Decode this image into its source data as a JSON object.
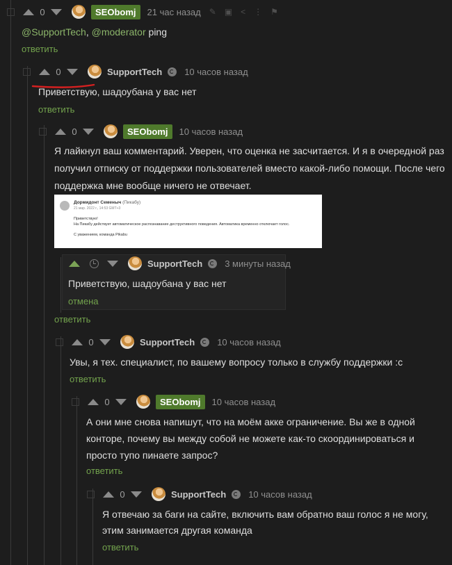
{
  "comments": [
    {
      "score": "0",
      "user": "SEObomj",
      "time": "21 час назад",
      "text_parts": [
        "@SupportTech",
        ", ",
        "@moderator",
        " ping"
      ],
      "reply": "ответить",
      "tools": [
        "link-icon",
        "save-icon",
        "share-icon",
        "more-icon",
        "report-icon"
      ]
    },
    {
      "score": "0",
      "user": "SupportTech",
      "time": "10 часов назад",
      "text": "Приветствую, шадоубана у вас нет",
      "reply": "ответить"
    },
    {
      "score": "0",
      "user": "SEObomj",
      "time": "10 часов назад",
      "lines": [
        "Я лайкнул ваш комментарий. Уверен, что оценка не засчитается. И я в очередной раз",
        "получил отписку от поддержки пользователей вместо какой-либо помощи. После чего",
        "поддержка мне вообще ничего не отвечает."
      ],
      "reply": "ответить",
      "screenshot": {
        "author": "Дормидонт Семеныч",
        "site": "(Пикабу)",
        "date": "21 мар. 2022 г., 14:53 GMT+3",
        "greeting": "Приветствую!",
        "body": "На Пикабу действует автоматическое распознавание деструктивного поведения. Автоматика временно отключает голос.",
        "sign": "С уважением, команда Pikabu"
      }
    },
    {
      "user": "SupportTech",
      "time": "3 минуты назад",
      "text": "Приветствую, шадоубана у вас нет",
      "cancel": "отмена"
    },
    {
      "score": "0",
      "user": "SupportTech",
      "time": "10 часов назад",
      "text": "Увы, я тех. специалист, по вашему вопросу только в службу поддержки :с",
      "reply": "ответить"
    },
    {
      "score": "0",
      "user": "SEObomj",
      "time": "10 часов назад",
      "lines": [
        "А они мне снова напишут, что на моём акке ограничение. Вы же в одной",
        "конторе, почему вы между собой не можете как-то скоординироваться и",
        "просто тупо пинаете запрос?"
      ],
      "reply": "ответить"
    },
    {
      "score": "0",
      "user": "SupportTech",
      "time": "10 часов назад",
      "lines": [
        "Я отвечаю за баги на сайте, включить вам обратно ваш голос я не могу,",
        "этим занимается другая команда"
      ],
      "reply": "ответить"
    }
  ],
  "colors": {
    "background": "#1d1d1d",
    "accent": "#73a34d",
    "badge": "#4f7a2c",
    "annotation": "#d42020"
  }
}
